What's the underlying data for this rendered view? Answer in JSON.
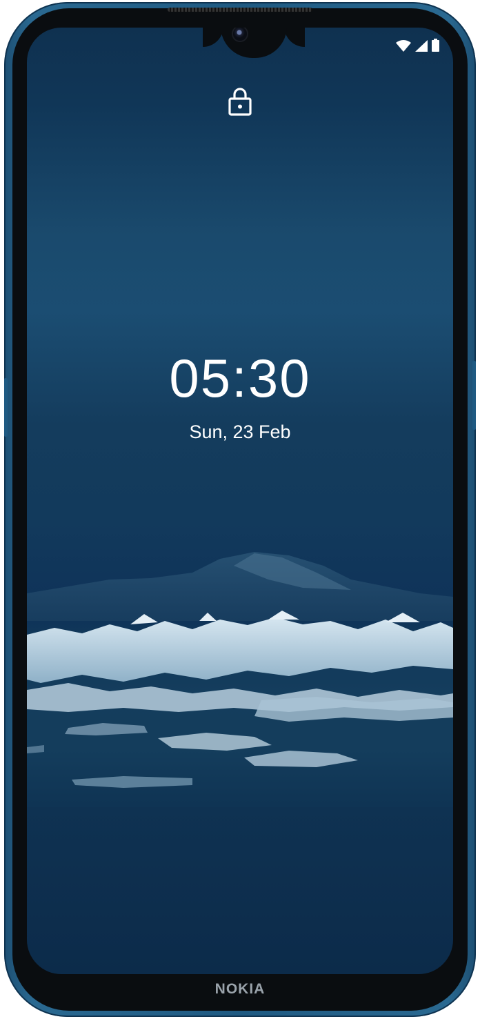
{
  "device": {
    "brand": "NOKIA"
  },
  "lockscreen": {
    "time": "05:30",
    "date": "Sun, 23 Feb",
    "lock_icon": "lock-icon"
  },
  "status_bar": {
    "icons": [
      "wifi-icon",
      "signal-icon",
      "battery-icon"
    ]
  },
  "colors": {
    "frame": "#1f5a82",
    "wallpaper_top": "#103657",
    "wallpaper_bottom": "#0c2b4a",
    "text": "#ffffff",
    "brand_text": "#9aa3ab"
  }
}
